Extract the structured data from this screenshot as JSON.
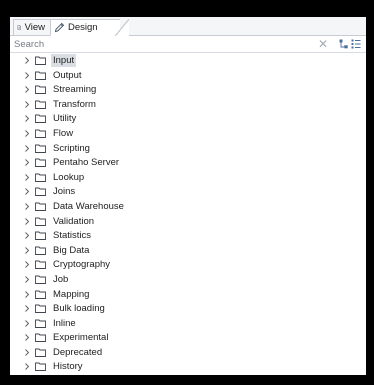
{
  "tabs": [
    {
      "label": "View",
      "icon": "document-icon",
      "active": false
    },
    {
      "label": "Design",
      "icon": "pencil-icon",
      "active": true
    }
  ],
  "search": {
    "placeholder": "Search",
    "value": ""
  },
  "toolbar_icons": [
    "clear-icon",
    "expand-all-icon",
    "collapse-all-icon"
  ],
  "tree": {
    "selected": "Input",
    "items": [
      {
        "label": "Input"
      },
      {
        "label": "Output"
      },
      {
        "label": "Streaming"
      },
      {
        "label": "Transform"
      },
      {
        "label": "Utility"
      },
      {
        "label": "Flow"
      },
      {
        "label": "Scripting"
      },
      {
        "label": "Pentaho Server"
      },
      {
        "label": "Lookup"
      },
      {
        "label": "Joins"
      },
      {
        "label": "Data Warehouse"
      },
      {
        "label": "Validation"
      },
      {
        "label": "Statistics"
      },
      {
        "label": "Big Data"
      },
      {
        "label": "Cryptography"
      },
      {
        "label": "Job"
      },
      {
        "label": "Mapping"
      },
      {
        "label": "Bulk loading"
      },
      {
        "label": "Inline"
      },
      {
        "label": "Experimental"
      },
      {
        "label": "Deprecated"
      },
      {
        "label": "History"
      }
    ]
  },
  "colors": {
    "background": "#000000",
    "panel": "#ffffff",
    "selection": "#d9dee5",
    "border": "#c7ccd4"
  }
}
